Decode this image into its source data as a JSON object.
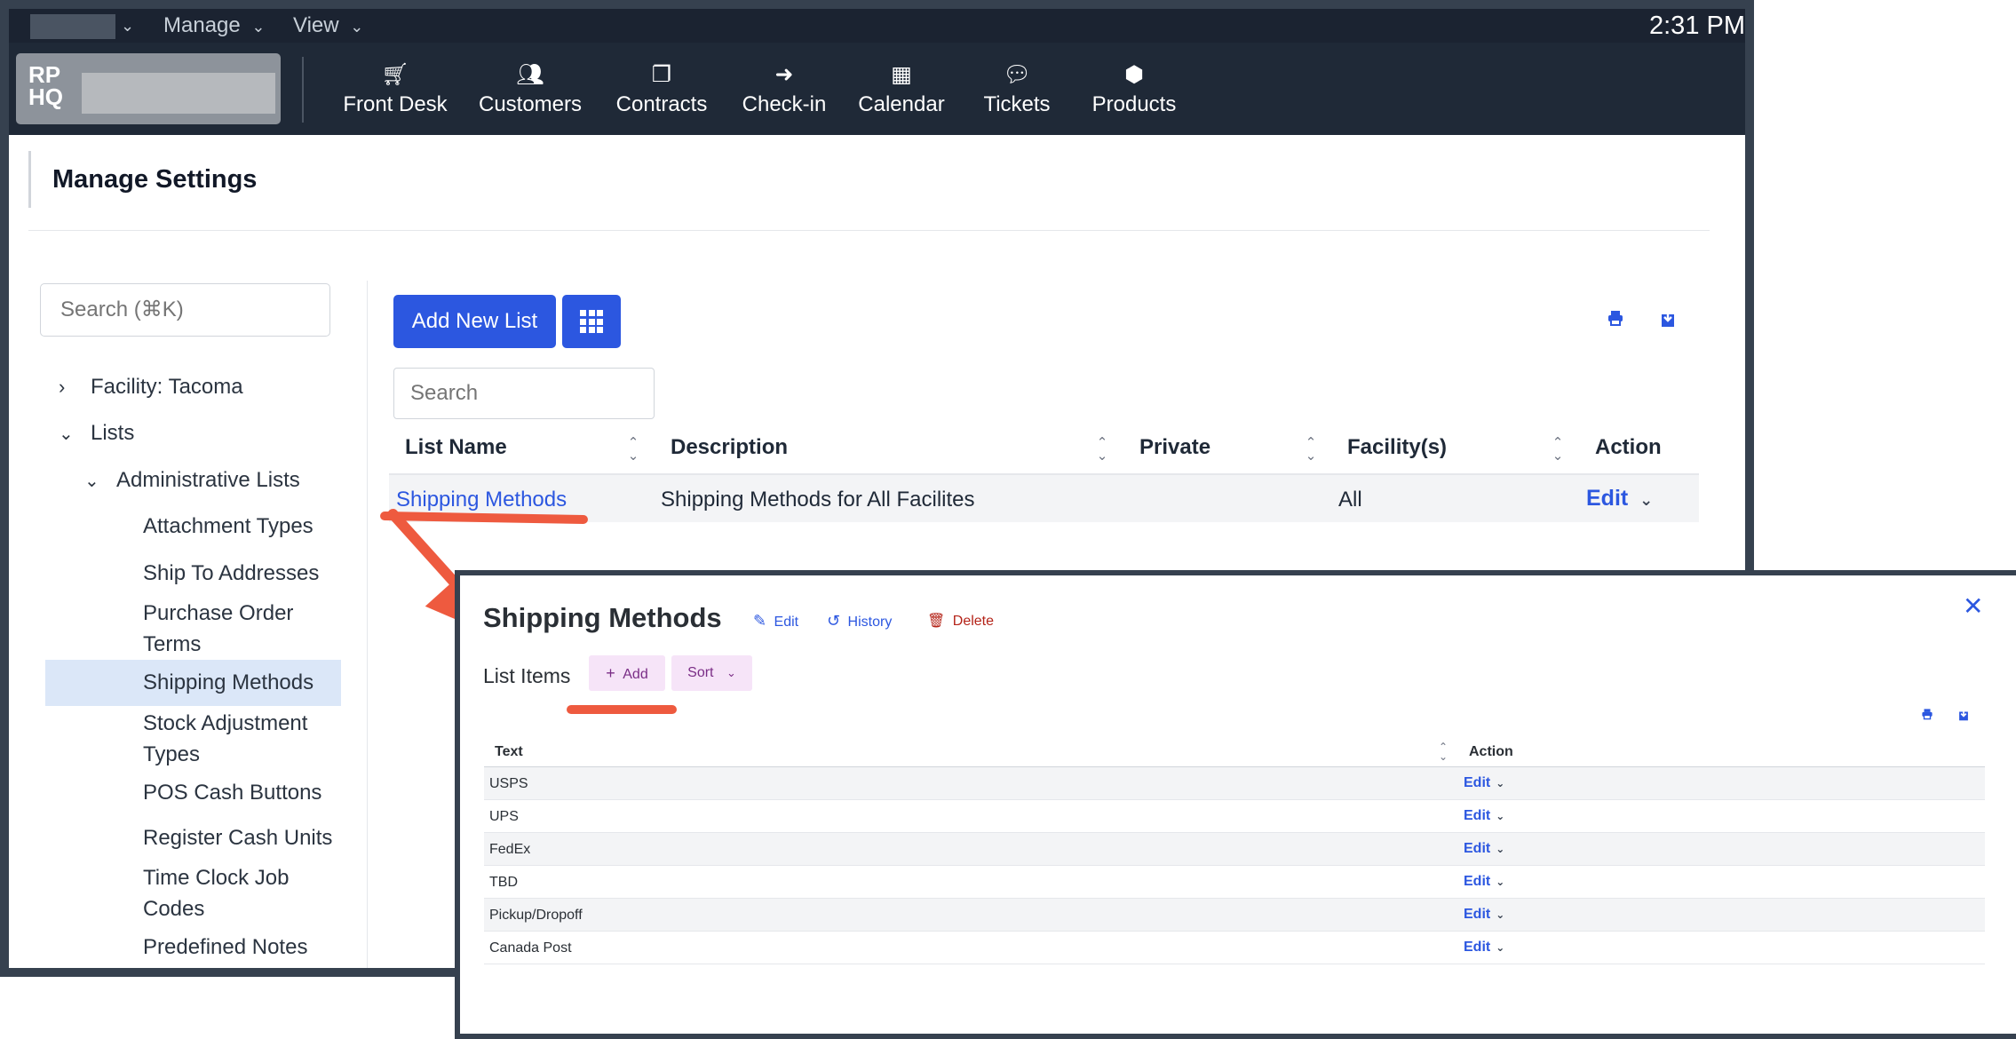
{
  "menubar": {
    "manage_label": "Manage",
    "view_label": "View",
    "clock": "2:31 PM"
  },
  "logo": {
    "line1": "RP",
    "line2": "HQ"
  },
  "nav": [
    {
      "label": "Front Desk",
      "icon": "cart-icon"
    },
    {
      "label": "Customers",
      "icon": "users-icon"
    },
    {
      "label": "Contracts",
      "icon": "contracts-icon"
    },
    {
      "label": "Check-in",
      "icon": "arrow-circle-icon"
    },
    {
      "label": "Calendar",
      "icon": "calendar-icon"
    },
    {
      "label": "Tickets",
      "icon": "comment-icon"
    },
    {
      "label": "Products",
      "icon": "box-icon"
    }
  ],
  "page": {
    "title": "Manage Settings"
  },
  "sidebar": {
    "search_placeholder": "Search (⌘K)",
    "items": [
      {
        "label": "Facility: Tacoma"
      },
      {
        "label": "Lists"
      },
      {
        "label": "Administrative Lists"
      },
      {
        "label": "Attachment Types"
      },
      {
        "label": "Ship To Addresses"
      },
      {
        "label": "Purchase Order Terms"
      },
      {
        "label": "Shipping Methods",
        "selected": true
      },
      {
        "label": "Stock Adjustment Types"
      },
      {
        "label": "POS Cash Buttons"
      },
      {
        "label": "Register Cash Units"
      },
      {
        "label": "Time Clock Job Codes"
      },
      {
        "label": "Predefined Notes"
      }
    ]
  },
  "main": {
    "add_button": "Add New List",
    "search_placeholder": "Search",
    "columns": [
      "List Name",
      "Description",
      "Private",
      "Facility(s)",
      "Action"
    ],
    "rows": [
      {
        "name": "Shipping Methods",
        "description": "Shipping Methods for All Facilites",
        "private": "",
        "facilities": "All",
        "action": "Edit"
      }
    ]
  },
  "modal": {
    "title": "Shipping Methods",
    "edit_label": "Edit",
    "history_label": "History",
    "delete_label": "Delete",
    "list_items_label": "List Items",
    "add_label": "Add",
    "sort_label": "Sort",
    "columns": [
      "Text",
      "Action"
    ],
    "items": [
      {
        "text": "USPS",
        "action": "Edit"
      },
      {
        "text": "UPS",
        "action": "Edit"
      },
      {
        "text": "FedEx",
        "action": "Edit"
      },
      {
        "text": "TBD",
        "action": "Edit"
      },
      {
        "text": "Pickup/Dropoff",
        "action": "Edit"
      },
      {
        "text": "Canada Post",
        "action": "Edit"
      }
    ]
  },
  "colors": {
    "accent": "#2c57e0",
    "annotation": "#ee5a3f",
    "delete": "#b42318",
    "chip_bg": "#f6e4f8",
    "chip_text": "#7a2d86"
  }
}
